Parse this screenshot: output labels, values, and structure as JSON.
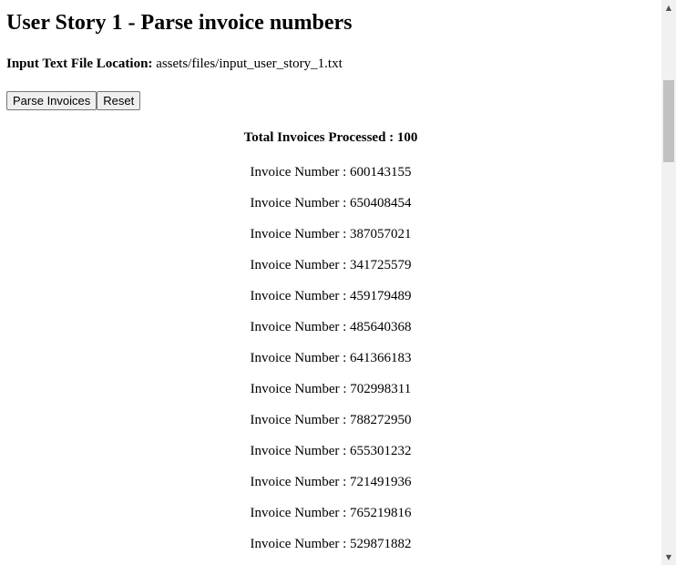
{
  "header": {
    "title": "User Story 1 - Parse invoice numbers"
  },
  "file": {
    "label": "Input Text File Location:",
    "path": "assets/files/input_user_story_1.txt"
  },
  "buttons": {
    "parse": "Parse Invoices",
    "reset": "Reset"
  },
  "results": {
    "total_label": "Total Invoices Processed : 100",
    "invoice_prefix": "Invoice Number : ",
    "invoices": [
      "600143155",
      "650408454",
      "387057021",
      "341725579",
      "459179489",
      "485640368",
      "641366183",
      "702998311",
      "788272950",
      "655301232",
      "721491936",
      "765219816",
      "529871882"
    ]
  },
  "scrollbar": {
    "up_icon": "triangle-up",
    "down_icon": "triangle-down",
    "scroll_position_fraction": 0.18
  }
}
